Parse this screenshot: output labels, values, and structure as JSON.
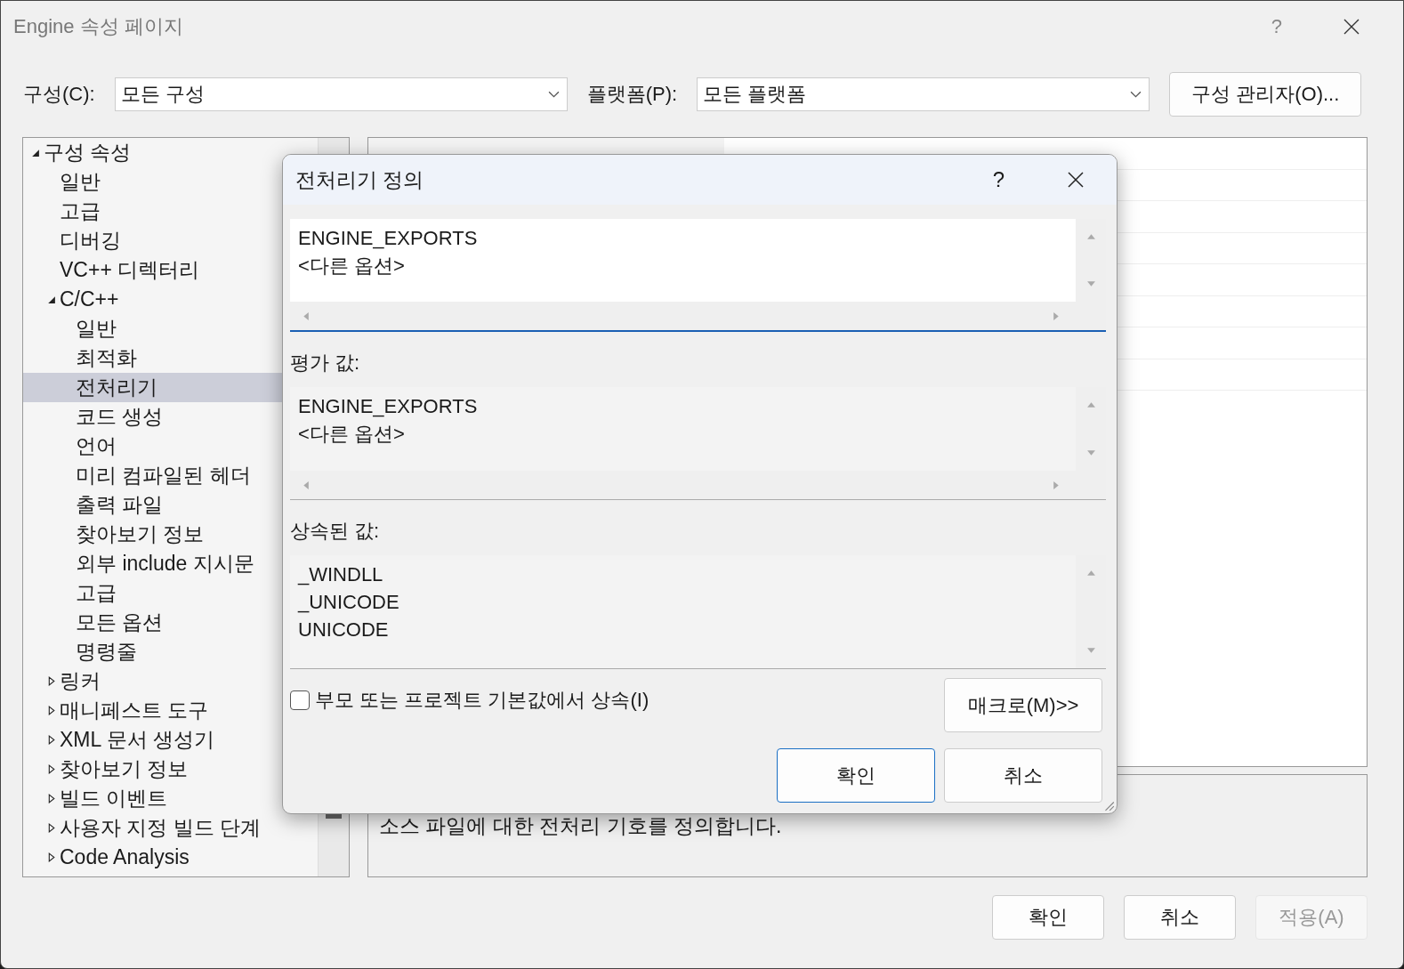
{
  "window": {
    "title": "Engine 속성 페이지",
    "help": "?"
  },
  "config": {
    "label": "구성(C):",
    "value": "모든 구성"
  },
  "platform": {
    "label": "플랫폼(P):",
    "value": "모든 플랫폼"
  },
  "config_manager_button": "구성 관리자(O)...",
  "tree": [
    {
      "label": "구성 속성",
      "expanded": true,
      "selected": false,
      "children": [
        {
          "label": "일반",
          "selected": false
        },
        {
          "label": "고급",
          "selected": false
        },
        {
          "label": "디버깅",
          "selected": false
        },
        {
          "label": "VC++ 디렉터리",
          "selected": false
        },
        {
          "label": "C/C++",
          "expanded": true,
          "selected": false,
          "children": [
            {
              "label": "일반",
              "selected": false
            },
            {
              "label": "최적화",
              "selected": false
            },
            {
              "label": "전처리기",
              "selected": true
            },
            {
              "label": "코드 생성",
              "selected": false
            },
            {
              "label": "언어",
              "selected": false
            },
            {
              "label": "미리 컴파일된 헤더",
              "selected": false
            },
            {
              "label": "출력 파일",
              "selected": false
            },
            {
              "label": "찾아보기 정보",
              "selected": false
            },
            {
              "label": "외부 include 지시문",
              "selected": false
            },
            {
              "label": "고급",
              "selected": false
            },
            {
              "label": "모든 옵션",
              "selected": false
            },
            {
              "label": "명령줄",
              "selected": false
            }
          ]
        },
        {
          "label": "링커",
          "expanded": false,
          "selected": false
        },
        {
          "label": "매니페스트 도구",
          "expanded": false,
          "selected": false
        },
        {
          "label": "XML 문서 생성기",
          "expanded": false,
          "selected": false
        },
        {
          "label": "찾아보기 정보",
          "expanded": false,
          "selected": false
        },
        {
          "label": "빌드 이벤트",
          "expanded": false,
          "selected": false
        },
        {
          "label": "사용자 지정 빌드 단계",
          "expanded": false,
          "selected": false
        },
        {
          "label": "Code Analysis",
          "expanded": false,
          "selected": false
        }
      ]
    }
  ],
  "description": "소스 파일에 대한 전처리 기호를 정의합니다.",
  "buttons": [
    {
      "label": "확인",
      "disabled": false
    },
    {
      "label": "취소",
      "disabled": false
    },
    {
      "label": "적용(A)",
      "disabled": true
    }
  ],
  "dialog": {
    "title": "전처리기 정의",
    "help": "?",
    "edit_lines": [
      "ENGINE_EXPORTS",
      "<다른 옵션>"
    ],
    "evaluated_label": "평가 값:",
    "evaluated_lines": [
      "ENGINE_EXPORTS",
      "<다른 옵션>"
    ],
    "inherited_label": "상속된 값:",
    "inherited_lines": [
      "_WINDLL",
      "_UNICODE",
      "UNICODE"
    ],
    "inherit": {
      "label": "부모 또는 프로젝트 기본값에서 상속(I)",
      "checked": false
    },
    "macros_button": "매크로(M)>>",
    "ok_button": "확인",
    "cancel_button": "취소"
  }
}
